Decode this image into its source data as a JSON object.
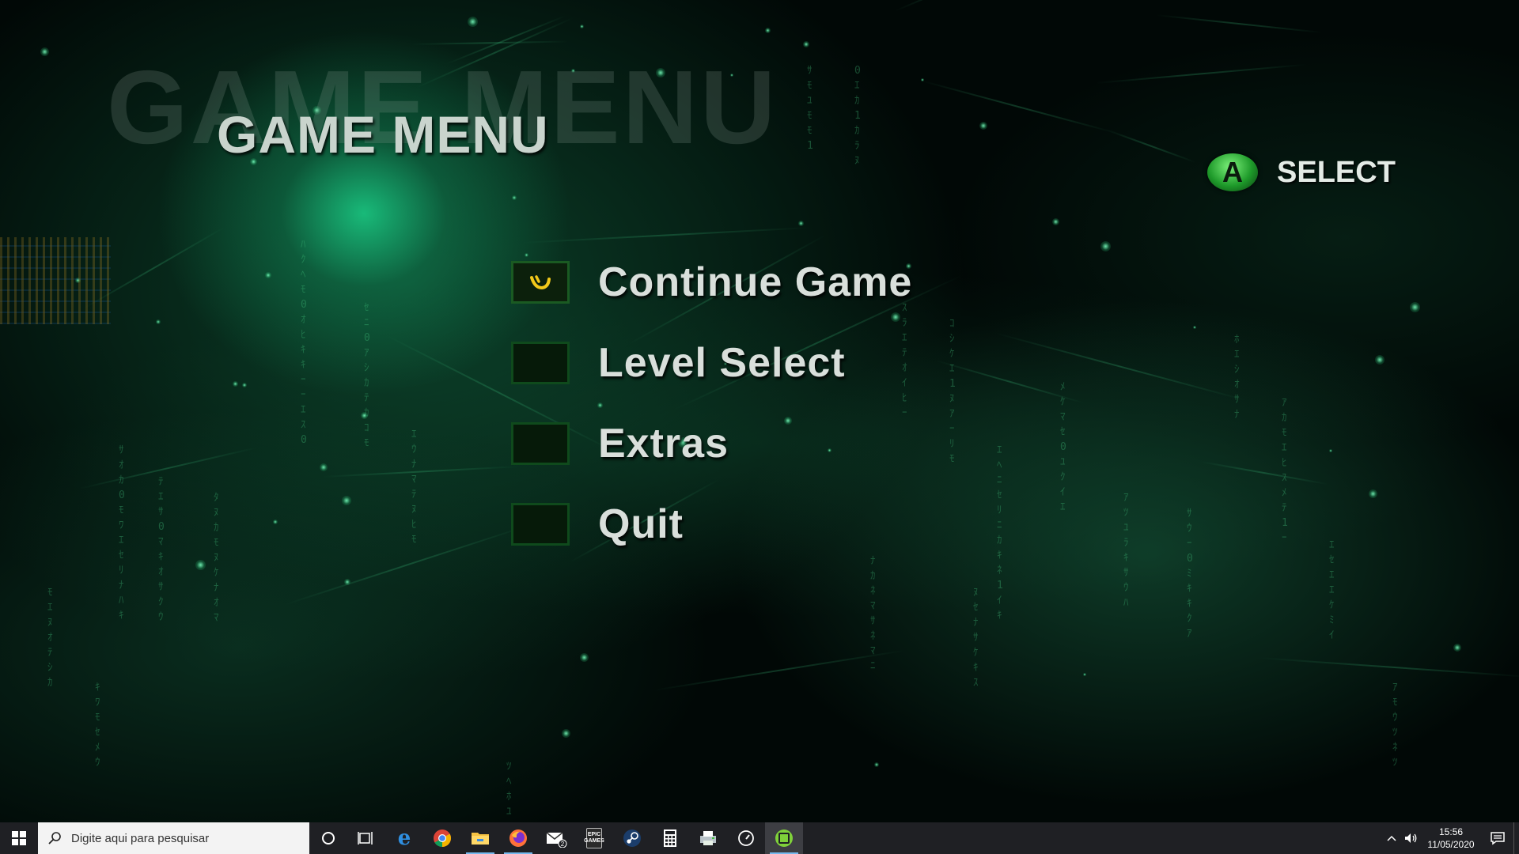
{
  "game": {
    "title_shadow": "GAME MENU",
    "title": "GAME MENU",
    "hint": {
      "button_icon": "a-button-icon",
      "button_letter": "A",
      "label": "SELECT"
    },
    "menu": {
      "selected_index": 0,
      "items": [
        {
          "label": "Continue Game",
          "selected": true
        },
        {
          "label": "Level Select",
          "selected": false
        },
        {
          "label": "Extras",
          "selected": false
        },
        {
          "label": "Quit",
          "selected": false
        }
      ]
    },
    "colors": {
      "accent_green": "#1e9a2a",
      "text": "#d9dfdb",
      "cursor_yellow": "#f2c81a"
    }
  },
  "taskbar": {
    "search_placeholder": "Digite aqui para pesquisar",
    "apps": [
      {
        "name": "cortana-icon",
        "running": false
      },
      {
        "name": "task-view-icon",
        "running": false
      },
      {
        "name": "edge-icon",
        "running": false
      },
      {
        "name": "chrome-icon",
        "running": false
      },
      {
        "name": "file-explorer-icon",
        "running": true
      },
      {
        "name": "firefox-icon",
        "running": true
      },
      {
        "name": "mail-icon",
        "running": false,
        "badge": "2"
      },
      {
        "name": "epic-games-icon",
        "running": false,
        "label": "EPIC GAMES"
      },
      {
        "name": "steam-icon",
        "running": false
      },
      {
        "name": "calculator-icon",
        "running": false
      },
      {
        "name": "printer-icon",
        "running": false
      },
      {
        "name": "speedometer-icon",
        "running": false
      },
      {
        "name": "game-app-icon",
        "running": true,
        "active": true
      }
    ],
    "clock": {
      "time": "15:56",
      "date": "11/05/2020"
    }
  }
}
